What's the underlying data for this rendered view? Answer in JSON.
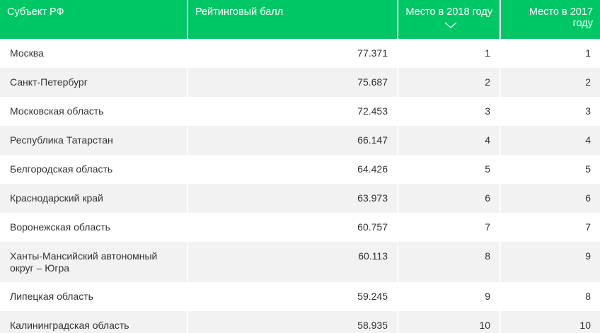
{
  "columns": {
    "subject": "Субъект РФ",
    "score": "Рейтинговый балл",
    "place2018": "Место в 2018 году",
    "place2017": "Место в 2017 году"
  },
  "sort_indicator_icon": "chevron-down-icon",
  "colors": {
    "header": "#00c766",
    "stripe": "#f2f2f2"
  },
  "rows": [
    {
      "subject": "Москва",
      "score": "77.371",
      "place2018": "1",
      "place2017": "1"
    },
    {
      "subject": "Санкт-Петербург",
      "score": "75.687",
      "place2018": "2",
      "place2017": "2"
    },
    {
      "subject": "Московская область",
      "score": "72.453",
      "place2018": "3",
      "place2017": "3"
    },
    {
      "subject": "Республика Татарстан",
      "score": "66.147",
      "place2018": "4",
      "place2017": "4"
    },
    {
      "subject": "Белгородская область",
      "score": "64.426",
      "place2018": "5",
      "place2017": "5"
    },
    {
      "subject": "Краснодарский край",
      "score": "63.973",
      "place2018": "6",
      "place2017": "6"
    },
    {
      "subject": "Воронежская область",
      "score": "60.757",
      "place2018": "7",
      "place2017": "7"
    },
    {
      "subject": "Ханты-Мансийский автономный округ – Югра",
      "score": "60.113",
      "place2018": "8",
      "place2017": "9"
    },
    {
      "subject": "Липецкая область",
      "score": "59.245",
      "place2018": "9",
      "place2017": "8"
    },
    {
      "subject": "Калининградская область",
      "score": "58.935",
      "place2018": "10",
      "place2017": "10"
    }
  ]
}
